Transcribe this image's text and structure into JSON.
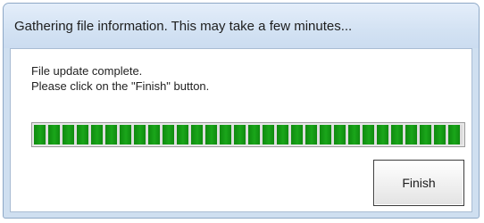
{
  "window": {
    "title": "Gathering file information. This may take a few minutes..."
  },
  "message": {
    "line1": "File update complete.",
    "line2": "Please click on the \"Finish\" button."
  },
  "progress": {
    "value_percent": 100,
    "color": "#1aa61a"
  },
  "buttons": {
    "finish_label": "Finish"
  }
}
